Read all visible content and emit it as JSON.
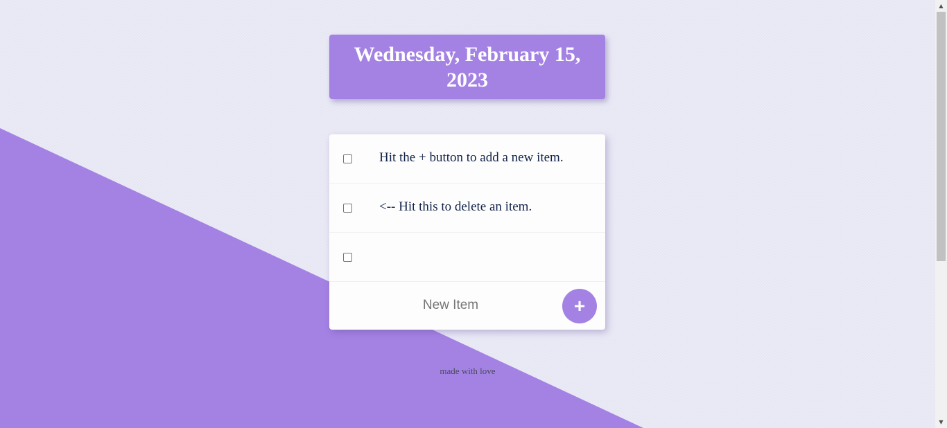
{
  "heading": {
    "date": "Wednesday, February 15, 2023"
  },
  "todo": {
    "items": [
      {
        "text": "Hit the + button to add a new item.",
        "checked": false
      },
      {
        "text": "<-- Hit this to delete an item.",
        "checked": false
      },
      {
        "text": "",
        "checked": false
      }
    ],
    "new_item_placeholder": "New Item",
    "add_button_label": "+"
  },
  "footer": {
    "text": "made with love"
  },
  "colors": {
    "accent": "#a482e4",
    "background": "#e6e6f4",
    "card": "#fdfdfd",
    "item_text": "#12234a"
  },
  "scrollbar": {
    "up_icon": "scroll-up-arrow-icon",
    "down_icon": "scroll-down-arrow-icon"
  }
}
